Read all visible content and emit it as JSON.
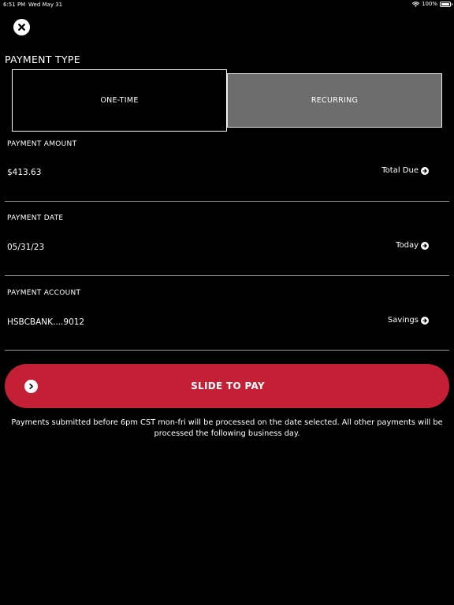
{
  "status_bar": {
    "time": "6:51 PM",
    "date": "Wed May 31",
    "battery": "100%"
  },
  "payment_type": {
    "title": "PAYMENT TYPE",
    "options": [
      "ONE-TIME",
      "RECURRING"
    ],
    "selected": "ONE-TIME"
  },
  "fields": {
    "amount": {
      "label": "PAYMENT AMOUNT",
      "value": "$413.63",
      "action": "Total Due"
    },
    "date": {
      "label": "PAYMENT DATE",
      "value": "05/31/23",
      "action": "Today"
    },
    "account": {
      "label": "PAYMENT ACCOUNT",
      "value": "HSBCBANK....9012",
      "action": "Savings"
    }
  },
  "slide_to_pay": {
    "label": "SLIDE TO PAY"
  },
  "notice": "Payments submitted before 6pm CST mon-fri will be processed on the date selected. All other payments will be processed the following business day.",
  "colors": {
    "background": "#000000",
    "accent": "#c41f35",
    "unselected_segment": "#6d6d6d",
    "divider": "#9a9a9a"
  },
  "icons": [
    "close-icon",
    "arrow-right-circle-icon",
    "wifi-icon",
    "battery-icon",
    "chevron-right-icon"
  ]
}
